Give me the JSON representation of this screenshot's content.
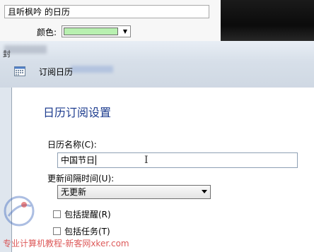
{
  "background_window": {
    "name_value": "且听枫吟 的日历",
    "color_label": "颜色:",
    "color_swatch": "#b8f0b0",
    "cut_label": "封"
  },
  "dialog": {
    "title": "订阅日历",
    "heading": "日历订阅设置",
    "calendar_name_label": "日历名称(C):",
    "calendar_name_value": "中国节日",
    "update_interval_label": "更新间隔时间(U):",
    "update_interval_value": "无更新",
    "include_reminders_label": "包括提醒(R)",
    "include_tasks_label": "包括任务(T)"
  },
  "watermark": {
    "text": "专业计算机教程-新客网xker.com",
    "color": "#d73c3c"
  }
}
